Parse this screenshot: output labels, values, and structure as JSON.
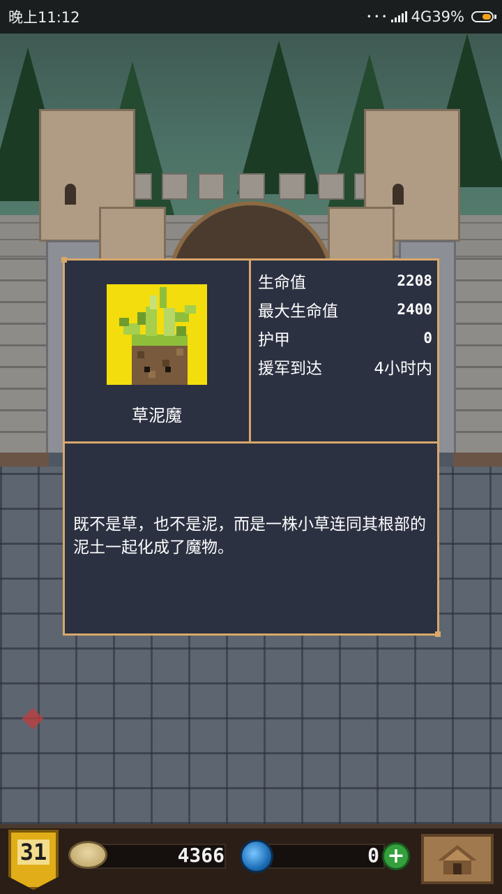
{
  "status_bar": {
    "time": "晚上11:12",
    "dots": "• • •",
    "network": "4G",
    "battery_percent": "39%",
    "battery_color": "#f2a21a"
  },
  "monster": {
    "name": "草泥魔",
    "portrait_icon": "grass-mud-monster-icon",
    "portrait_background": "#f3dd0d",
    "stats": [
      {
        "label": "生命值",
        "value": "2208"
      },
      {
        "label": "最大生命值",
        "value": "2400"
      },
      {
        "label": "护甲",
        "value": "0"
      },
      {
        "label": "援军到达",
        "value": "4小时内"
      }
    ],
    "description": "既不是草，也不是泥，而是一株小草连同其根部的泥土一起化成了魔物。"
  },
  "bottom_bar": {
    "level": "31",
    "gold": "4366",
    "gems": "0",
    "add_label": "+",
    "gold_icon": "coin-icon",
    "gem_icon": "blue-gem-icon",
    "home_icon": "home-icon"
  }
}
